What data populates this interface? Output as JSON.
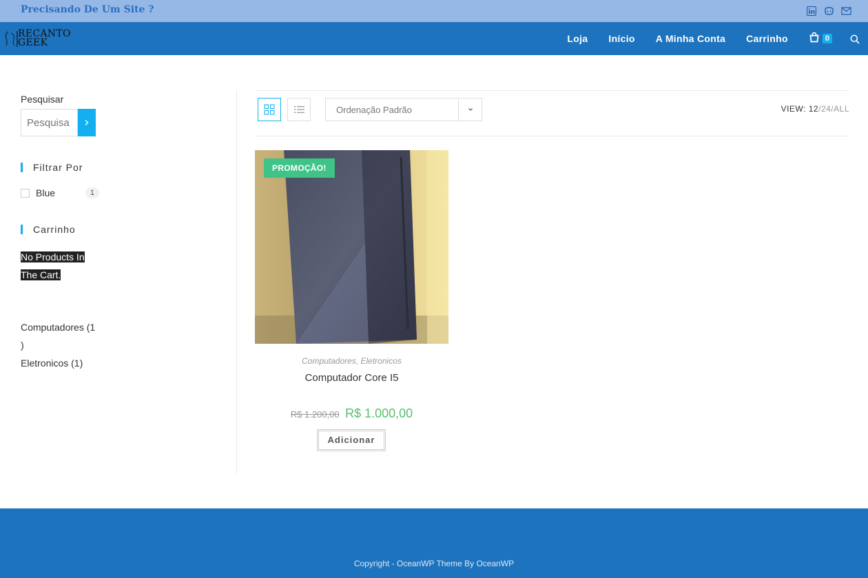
{
  "topbar": {
    "promo": "Precisando De Um Site ?",
    "social": [
      "linkedin-icon",
      "github-icon",
      "mail-icon"
    ]
  },
  "header": {
    "logo_line1": "RECANTO",
    "logo_line2": "GEEK",
    "nav": [
      "Loja",
      "Início",
      "A Minha Conta",
      "Carrinho"
    ],
    "cart_count": "0"
  },
  "sidebar": {
    "search_label": "Pesquisar",
    "search_placeholder": "Pesquisa",
    "filter_title": "Filtrar Por",
    "filter_item": "Blue",
    "filter_count": "1",
    "cart_title": "Carrinho",
    "empty_cart": "No Products In The Cart.",
    "categories": [
      "Computadores (1 )",
      "Eletronicos (1)"
    ]
  },
  "toolbar": {
    "orderby": "Ordenação Padrão",
    "view_label": "VIEW:",
    "view_options": [
      "12",
      "24",
      "ALL"
    ]
  },
  "product": {
    "badge": "PROMOÇÃO!",
    "category1": "Computadores",
    "category2": "Eletronicos",
    "title": "Computador Core I5",
    "price_old": "R$ 1.200,00",
    "price_new": "R$ 1.000,00",
    "add_button": "Adicionar"
  },
  "footer": {
    "copyright": "Copyright - OceanWP Theme By OceanWP"
  },
  "colors": {
    "accent": "#13aff0",
    "header": "#1e73be",
    "topbar": "#96b8e6",
    "sale": "#3fc387",
    "price": "#57bf6d"
  }
}
